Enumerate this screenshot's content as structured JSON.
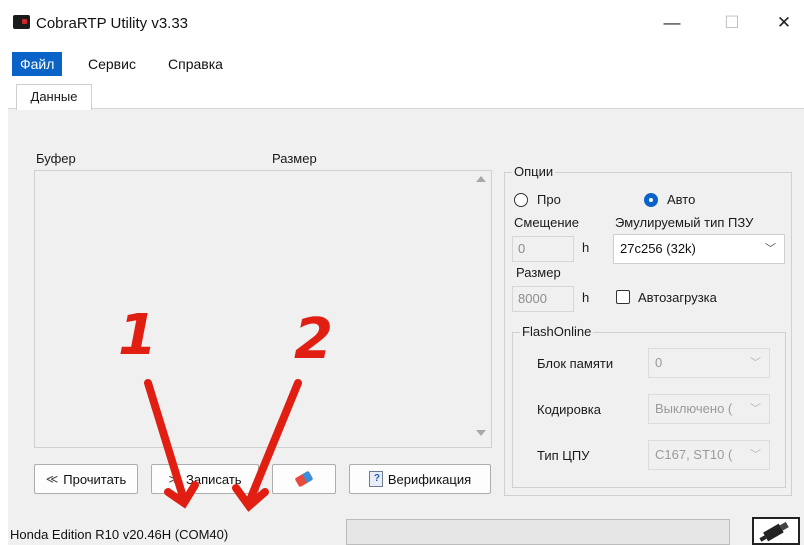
{
  "window": {
    "title": "CobraRTP Utility v3.33",
    "minimize_glyph": "—",
    "maximize_glyph": "☐",
    "close_glyph": "✕"
  },
  "menu": {
    "items": [
      "Файл",
      "Сервис",
      "Справка"
    ],
    "active": "Файл"
  },
  "tabs": [
    {
      "label": "Данные",
      "selected": true
    }
  ],
  "buffer": {
    "col_buffer": "Буфер",
    "col_size": "Размер"
  },
  "options": {
    "title": "Опции",
    "radio_pro": "Про",
    "radio_auto": "Авто",
    "selected_mode": "Авто",
    "offset_label": "Смещение",
    "offset_value": "0",
    "offset_suffix": "h",
    "emul_label": "Эмулируемый тип ПЗУ",
    "emul_value": "27c256 (32k)",
    "size_label": "Размер",
    "size_value": "8000",
    "size_suffix": "h",
    "autoload_label": "Автозагрузка",
    "autoload_checked": false
  },
  "flash": {
    "title": "FlashOnline",
    "mem_label": "Блок памяти",
    "mem_value": "0",
    "enc_label": "Кодировка",
    "enc_value": "Выключено (",
    "cpu_label": "Тип ЦПУ",
    "cpu_value": "C167, ST10 (",
    "chevron": "﹀"
  },
  "buttons": {
    "read": "Прочитать",
    "write": "Записать",
    "verify": "Верификация"
  },
  "status": {
    "text": "Honda Edition R10  v20.46H (COM40)",
    "progress": 0.0
  },
  "annotations": [
    "1",
    "2"
  ],
  "colors": {
    "accent": "#0a64c8",
    "annotation": "#e01e12",
    "progress": "#06b025"
  }
}
